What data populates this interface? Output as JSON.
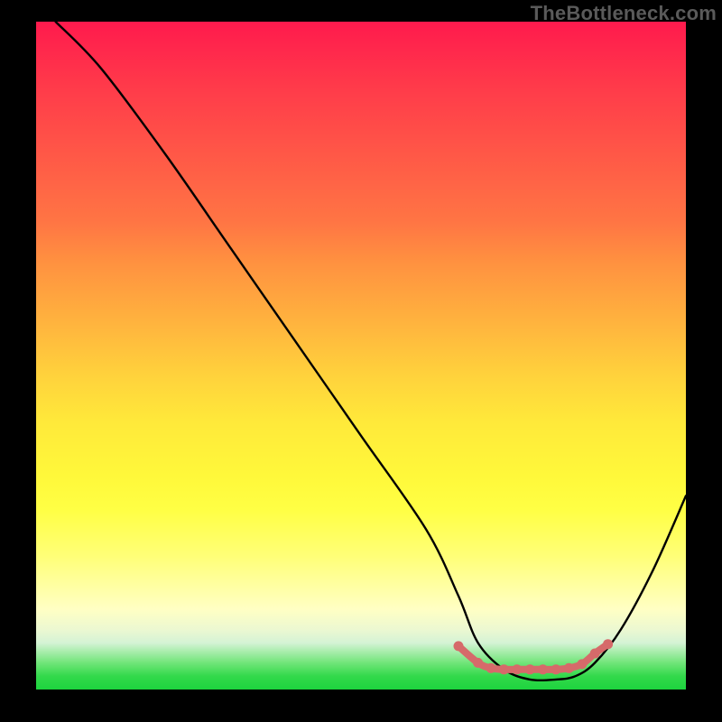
{
  "watermark": "TheBottleneck.com",
  "chart_data": {
    "type": "line",
    "title": "",
    "xlabel": "",
    "ylabel": "",
    "xlim": [
      0,
      100
    ],
    "ylim": [
      0,
      100
    ],
    "series": [
      {
        "name": "bottleneck-curve",
        "x": [
          3,
          10,
          20,
          30,
          40,
          50,
          60,
          65,
          68,
          72,
          76,
          80,
          83,
          86,
          90,
          95,
          100
        ],
        "values": [
          100,
          93,
          80,
          66,
          52,
          38,
          24,
          14,
          7,
          3,
          1.5,
          1.5,
          2,
          4,
          9,
          18,
          29
        ]
      }
    ],
    "flat_markers": {
      "name": "optimal-range-markers",
      "x": [
        65,
        68,
        70,
        72,
        74,
        76,
        78,
        80,
        82,
        84,
        86,
        88
      ],
      "values": [
        6.5,
        4,
        3.2,
        3,
        3,
        3,
        3,
        3,
        3.2,
        3.8,
        5.4,
        6.8
      ]
    },
    "gradient_stops": [
      {
        "pct": 0,
        "color": "#ff1a4d"
      },
      {
        "pct": 10,
        "color": "#ff3b4a"
      },
      {
        "pct": 20,
        "color": "#ff5847"
      },
      {
        "pct": 30,
        "color": "#ff7544"
      },
      {
        "pct": 36,
        "color": "#ff9140"
      },
      {
        "pct": 45,
        "color": "#ffb33e"
      },
      {
        "pct": 53,
        "color": "#ffd23c"
      },
      {
        "pct": 60,
        "color": "#ffe93a"
      },
      {
        "pct": 68,
        "color": "#fff83a"
      },
      {
        "pct": 73,
        "color": "#ffff44"
      },
      {
        "pct": 80,
        "color": "#ffff77"
      },
      {
        "pct": 88,
        "color": "#ffffc4"
      },
      {
        "pct": 91,
        "color": "#ecf8d1"
      },
      {
        "pct": 93,
        "color": "#d5f3d5"
      },
      {
        "pct": 96,
        "color": "#71e579"
      },
      {
        "pct": 98,
        "color": "#33d94b"
      },
      {
        "pct": 100,
        "color": "#1dd43e"
      }
    ],
    "colors": {
      "curve": "#000000",
      "marker": "#d66a6a",
      "background_frame": "#000000"
    }
  }
}
